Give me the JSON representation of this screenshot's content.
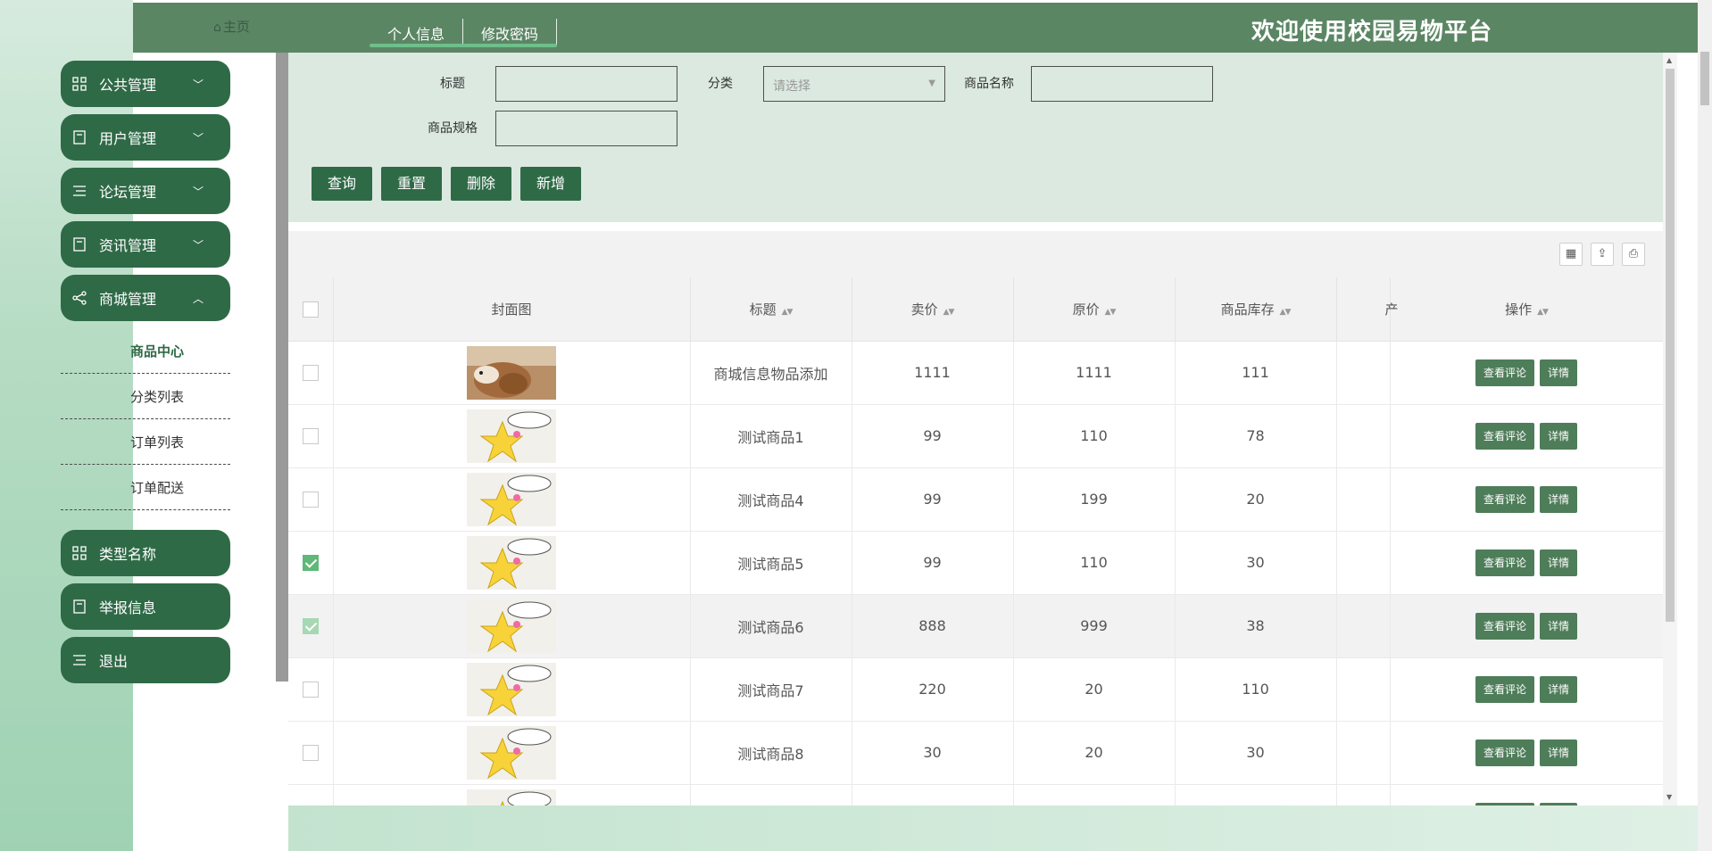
{
  "header": {
    "home_label": "主页",
    "tabs": [
      "个人信息",
      "修改密码"
    ],
    "welcome": "欢迎使用校园易物平台",
    "bg_color": "#5b8664"
  },
  "sidebar": {
    "items": [
      {
        "label": "公共管理",
        "icon": "grid-icon",
        "expanded": false
      },
      {
        "label": "用户管理",
        "icon": "book-icon",
        "expanded": false
      },
      {
        "label": "论坛管理",
        "icon": "list-icon",
        "expanded": false
      },
      {
        "label": "资讯管理",
        "icon": "book-icon",
        "expanded": false
      },
      {
        "label": "商城管理",
        "icon": "share-icon",
        "expanded": true
      }
    ],
    "sub_items": [
      "商品中心",
      "分类列表",
      "订单列表",
      "订单配送"
    ],
    "active_sub": "商品中心",
    "bottom_items": [
      {
        "label": "类型名称",
        "icon": "grid-icon"
      },
      {
        "label": "举报信息",
        "icon": "book-icon"
      },
      {
        "label": "退出",
        "icon": "list-icon"
      }
    ],
    "accent": "#2f6a47"
  },
  "search": {
    "title_label": "标题",
    "title_value": "",
    "category_label": "分类",
    "category_placeholder": "请选择",
    "name_label": "商品名称",
    "name_value": "",
    "spec_label": "商品规格",
    "spec_value": "",
    "buttons": {
      "query": "查询",
      "reset": "重置",
      "delete": "删除",
      "add": "新增"
    }
  },
  "toolbar_icons": [
    "columns-icon",
    "export-icon",
    "print-icon"
  ],
  "table": {
    "columns": [
      "封面图",
      "标题",
      "卖价",
      "原价",
      "商品库存",
      "产",
      "操作"
    ],
    "sortable": [
      false,
      true,
      true,
      true,
      true,
      false,
      true
    ],
    "rows": [
      {
        "checked": false,
        "image": "dog-photo",
        "title": "商城信息物品添加",
        "price": "1111",
        "original": "1111",
        "stock": "111"
      },
      {
        "checked": false,
        "image": "star-cartoon",
        "title": "测试商品1",
        "price": "99",
        "original": "110",
        "stock": "78"
      },
      {
        "checked": false,
        "image": "star-cartoon",
        "title": "测试商品4",
        "price": "99",
        "original": "199",
        "stock": "20"
      },
      {
        "checked": true,
        "image": "star-cartoon",
        "title": "测试商品5",
        "price": "99",
        "original": "110",
        "stock": "30"
      },
      {
        "checked": true,
        "image": "star-cartoon",
        "title": "测试商品6",
        "price": "888",
        "original": "999",
        "stock": "38"
      },
      {
        "checked": false,
        "image": "star-cartoon",
        "title": "测试商品7",
        "price": "220",
        "original": "20",
        "stock": "110"
      },
      {
        "checked": false,
        "image": "star-cartoon",
        "title": "测试商品8",
        "price": "30",
        "original": "20",
        "stock": "30"
      },
      {
        "checked": false,
        "image": "star-cartoon",
        "title": "",
        "price": "",
        "original": "",
        "stock": ""
      }
    ],
    "actions": {
      "comments": "查看评论",
      "detail": "详情"
    }
  }
}
